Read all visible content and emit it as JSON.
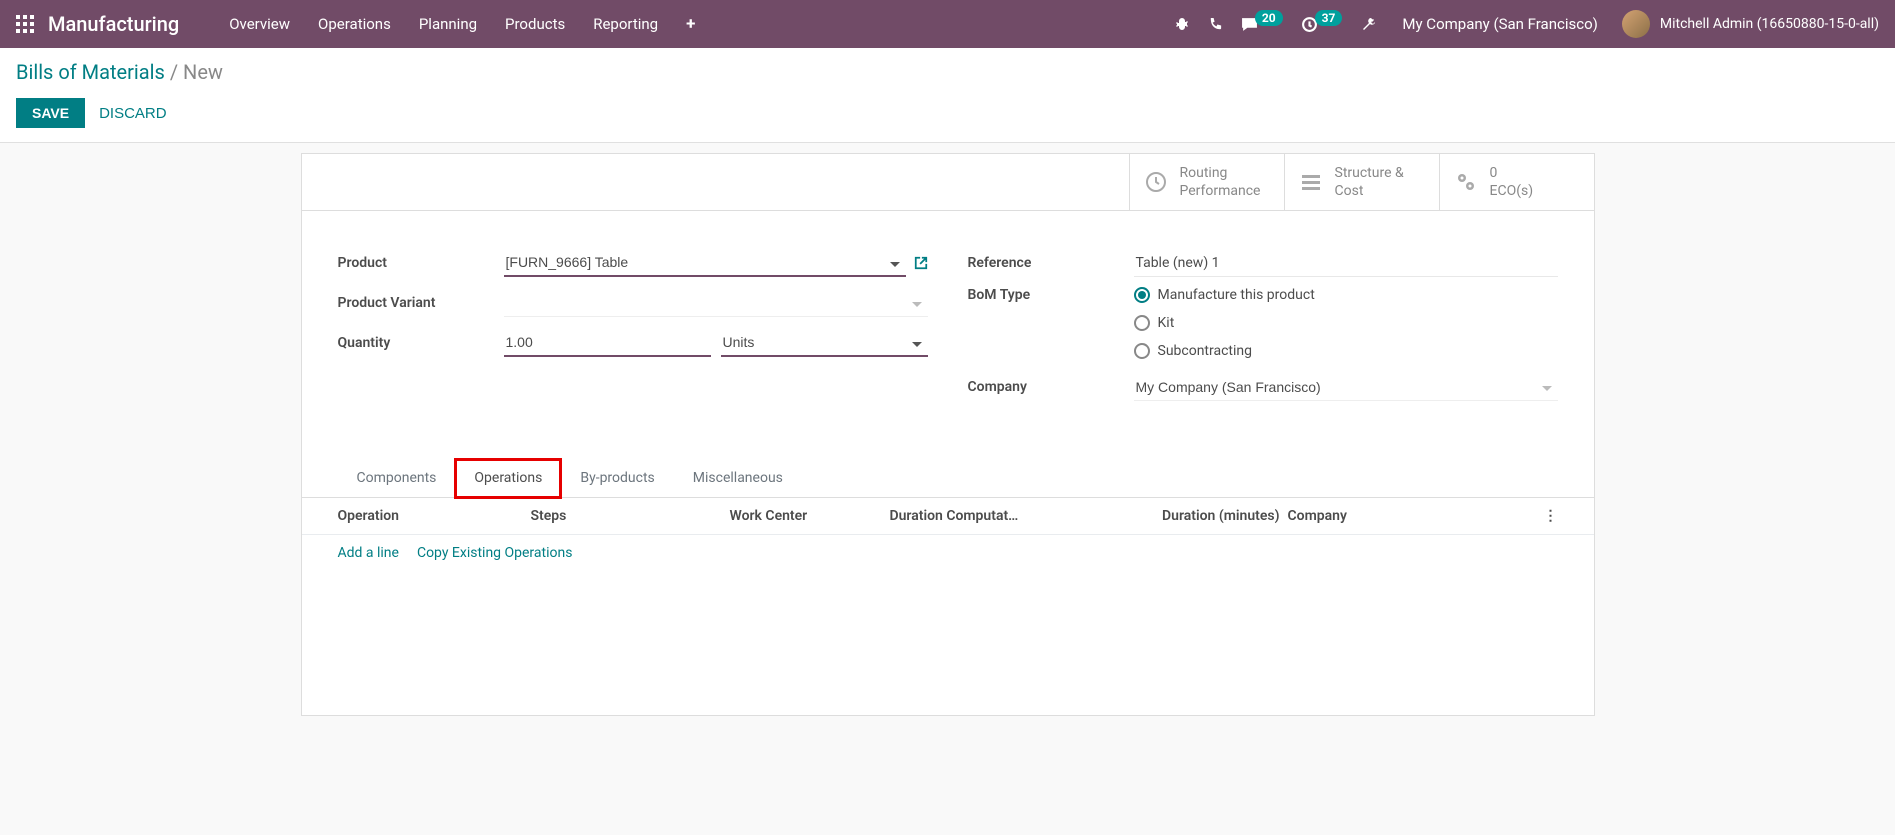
{
  "nav": {
    "app_title": "Manufacturing",
    "menu": [
      "Overview",
      "Operations",
      "Planning",
      "Products",
      "Reporting"
    ],
    "msg_badge": "20",
    "activity_badge": "37",
    "company": "My Company (San Francisco)",
    "user": "Mitchell Admin (16650880-15-0-all)"
  },
  "breadcrumb": {
    "main": "Bills of Materials",
    "current": "New"
  },
  "actions": {
    "save": "SAVE",
    "discard": "DISCARD"
  },
  "stats": {
    "routing": {
      "line1": "Routing",
      "line2": "Performance"
    },
    "structure": {
      "line1": "Structure &",
      "line2": "Cost"
    },
    "eco": {
      "line1": "0",
      "line2": "ECO(s)"
    }
  },
  "form": {
    "labels": {
      "product": "Product",
      "variant": "Product Variant",
      "quantity": "Quantity",
      "reference": "Reference",
      "bom_type": "BoM Type",
      "company": "Company"
    },
    "product_value": "[FURN_9666] Table",
    "variant_value": "",
    "qty_value": "1.00",
    "qty_unit": "Units",
    "reference_value": "Table (new) 1",
    "bom_options": {
      "manufacture": "Manufacture this product",
      "kit": "Kit",
      "subcontracting": "Subcontracting"
    },
    "company_value": "My Company (San Francisco)"
  },
  "tabs": {
    "components": "Components",
    "operations": "Operations",
    "byproducts": "By-products",
    "misc": "Miscellaneous"
  },
  "table": {
    "headers": {
      "operation": "Operation",
      "steps": "Steps",
      "work_center": "Work Center",
      "duration_comp": "Duration Computat…",
      "duration_min": "Duration (minutes)",
      "company": "Company"
    },
    "add_line": "Add a line",
    "copy_ops": "Copy Existing Operations"
  }
}
